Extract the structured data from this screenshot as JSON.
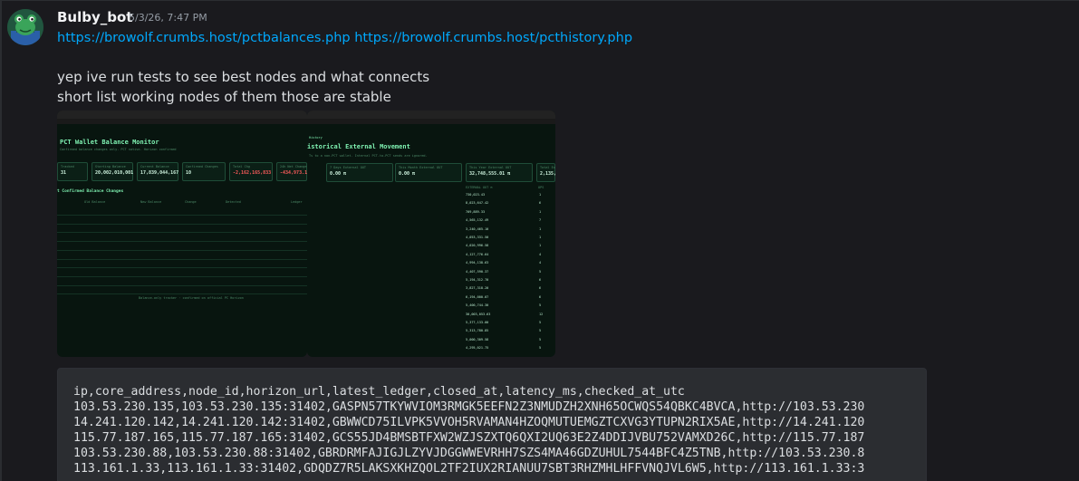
{
  "message": {
    "author": "Bulby_bot",
    "timestamp": "5/3/26, 7:47 PM",
    "links": [
      "https://browolf.crumbs.host/pctbalances.php",
      "https://browolf.crumbs.host/pcthistory.php"
    ],
    "lines": [
      "yep ive run tests to see best nodes and what connects",
      "short list working nodes of them those are stable"
    ]
  },
  "attachments": {
    "left": {
      "title": "PCT Wallet Balance Monitor",
      "subtitle": "Confirmed balance changes only. PCT native. Horizon confirmed",
      "section": "t Confirmed Balance Changes",
      "cards": [
        {
          "label": "Tracked",
          "value": "31"
        },
        {
          "label": "Starting Balance",
          "value": "20,002,010,001"
        },
        {
          "label": "Current Balance",
          "value": "17,839,044,167"
        },
        {
          "label": "Confirmed Changes",
          "value": "10"
        },
        {
          "label": "Total Chg",
          "value": "-2,162,165,833"
        },
        {
          "label": "24h Net Change",
          "value": "-434,973.1"
        }
      ],
      "columns": [
        "Old Balance",
        "New Balance",
        "Change",
        "Detected",
        "Ledger"
      ],
      "footer": "Balance-only tracker · confirmed on official PC Horizon"
    },
    "right": {
      "breadcrumb": "History",
      "title": "istorical External Movement",
      "subtitle": "Ts to a non-PCT wallet. Internal PCT-to-PCT sends are ignored.",
      "cards": [
        {
          "label": "7 Days External OUT",
          "value": "0.00 π"
        },
        {
          "label": "This Month External OUT",
          "value": "0.00 π"
        },
        {
          "label": "This Year External OUT",
          "value": "32,748,555.01 π"
        },
        {
          "label": "Total Exter",
          "value": "2,135,01"
        }
      ],
      "columns": [
        "EXTERNAL OUT π",
        "OPS"
      ],
      "values": [
        "730,023.43",
        "8,023,647.42",
        "709,889.33",
        "4,565,132.49",
        "3,240,465.10",
        "4,053,331.50",
        "4,020,996.58",
        "4,127,776.64",
        "4,994,138.63",
        "4,407,590.37",
        "5,194,312.70",
        "3,827,318.20",
        "6,194,000.07",
        "5,400,744.30",
        "30,003,053.63",
        "5,377,133.00",
        "5,313,780.85",
        "5,000,309.58",
        "4,295,021.75"
      ],
      "ops": [
        "1",
        "6",
        "1",
        "7",
        "1",
        "1",
        "1",
        "4",
        "4",
        "5",
        "6",
        "6",
        "6",
        "5",
        "12",
        "5",
        "5",
        "5",
        "5"
      ]
    }
  },
  "code_block": {
    "lines": [
      "ip,core_address,node_id,horizon_url,latest_ledger,closed_at,latency_ms,checked_at_utc",
      "103.53.230.135,103.53.230.135:31402,GASPN57TKYWVIOM3RMGK5EEFN2Z3NMUDZH2XNH65OCWQS54QBKC4BVCA,http://103.53.230",
      "14.241.120.142,14.241.120.142:31402,GBWWCD75ILVPK5VVOH5RVAMAN4HZOQMUTUEMGZTCXVG3YTUPN2RIX5AE,http://14.241.120",
      "115.77.187.165,115.77.187.165:31402,GCS55JD4BMSBTFXW2WZJSZXTQ6QXI2UQ63E2Z4DDIJVBU752VAMXD26C,http://115.77.187",
      "103.53.230.88,103.53.230.88:31402,GBRDRMFAJIGJLZYVJDGGWWEVRHH7SZS4MA46GDZUHUL7544BFC4Z5TNB,http://103.53.230.8",
      "113.161.1.33,113.161.1.33:31402,GDQDZ7R5LAKSXKHZQOL2TF2IUX2RIANUU7SBT3RHZMHLHFFVNQJVL6W5,http://113.161.1.33:3"
    ]
  },
  "colors": {
    "background": "#1a1a1e",
    "link": "#00a8fc",
    "text": "#dbdee1",
    "code_bg": "#2b2d31",
    "terminal_green": "#7ff2b2",
    "negative": "#ff5c5c"
  }
}
